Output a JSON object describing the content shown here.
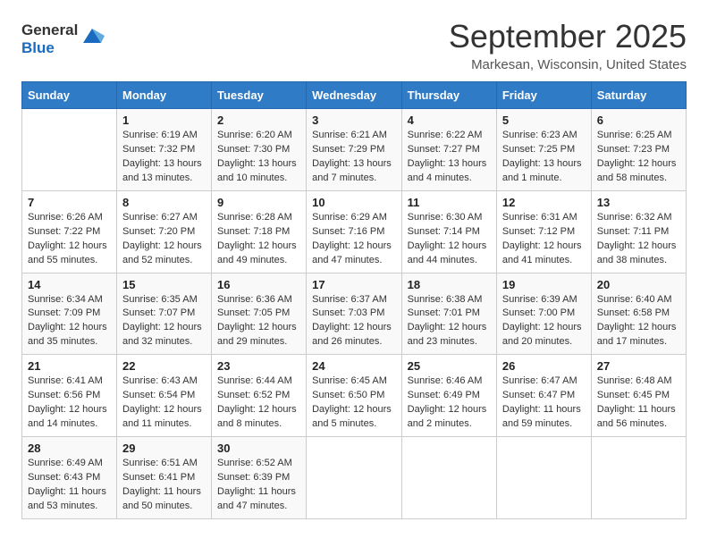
{
  "logo": {
    "general": "General",
    "blue": "Blue"
  },
  "title": "September 2025",
  "location": "Markesan, Wisconsin, United States",
  "weekdays": [
    "Sunday",
    "Monday",
    "Tuesday",
    "Wednesday",
    "Thursday",
    "Friday",
    "Saturday"
  ],
  "weeks": [
    [
      {
        "day": "",
        "info": ""
      },
      {
        "day": "1",
        "info": "Sunrise: 6:19 AM\nSunset: 7:32 PM\nDaylight: 13 hours and 13 minutes."
      },
      {
        "day": "2",
        "info": "Sunrise: 6:20 AM\nSunset: 7:30 PM\nDaylight: 13 hours and 10 minutes."
      },
      {
        "day": "3",
        "info": "Sunrise: 6:21 AM\nSunset: 7:29 PM\nDaylight: 13 hours and 7 minutes."
      },
      {
        "day": "4",
        "info": "Sunrise: 6:22 AM\nSunset: 7:27 PM\nDaylight: 13 hours and 4 minutes."
      },
      {
        "day": "5",
        "info": "Sunrise: 6:23 AM\nSunset: 7:25 PM\nDaylight: 13 hours and 1 minute."
      },
      {
        "day": "6",
        "info": "Sunrise: 6:25 AM\nSunset: 7:23 PM\nDaylight: 12 hours and 58 minutes."
      }
    ],
    [
      {
        "day": "7",
        "info": "Sunrise: 6:26 AM\nSunset: 7:22 PM\nDaylight: 12 hours and 55 minutes."
      },
      {
        "day": "8",
        "info": "Sunrise: 6:27 AM\nSunset: 7:20 PM\nDaylight: 12 hours and 52 minutes."
      },
      {
        "day": "9",
        "info": "Sunrise: 6:28 AM\nSunset: 7:18 PM\nDaylight: 12 hours and 49 minutes."
      },
      {
        "day": "10",
        "info": "Sunrise: 6:29 AM\nSunset: 7:16 PM\nDaylight: 12 hours and 47 minutes."
      },
      {
        "day": "11",
        "info": "Sunrise: 6:30 AM\nSunset: 7:14 PM\nDaylight: 12 hours and 44 minutes."
      },
      {
        "day": "12",
        "info": "Sunrise: 6:31 AM\nSunset: 7:12 PM\nDaylight: 12 hours and 41 minutes."
      },
      {
        "day": "13",
        "info": "Sunrise: 6:32 AM\nSunset: 7:11 PM\nDaylight: 12 hours and 38 minutes."
      }
    ],
    [
      {
        "day": "14",
        "info": "Sunrise: 6:34 AM\nSunset: 7:09 PM\nDaylight: 12 hours and 35 minutes."
      },
      {
        "day": "15",
        "info": "Sunrise: 6:35 AM\nSunset: 7:07 PM\nDaylight: 12 hours and 32 minutes."
      },
      {
        "day": "16",
        "info": "Sunrise: 6:36 AM\nSunset: 7:05 PM\nDaylight: 12 hours and 29 minutes."
      },
      {
        "day": "17",
        "info": "Sunrise: 6:37 AM\nSunset: 7:03 PM\nDaylight: 12 hours and 26 minutes."
      },
      {
        "day": "18",
        "info": "Sunrise: 6:38 AM\nSunset: 7:01 PM\nDaylight: 12 hours and 23 minutes."
      },
      {
        "day": "19",
        "info": "Sunrise: 6:39 AM\nSunset: 7:00 PM\nDaylight: 12 hours and 20 minutes."
      },
      {
        "day": "20",
        "info": "Sunrise: 6:40 AM\nSunset: 6:58 PM\nDaylight: 12 hours and 17 minutes."
      }
    ],
    [
      {
        "day": "21",
        "info": "Sunrise: 6:41 AM\nSunset: 6:56 PM\nDaylight: 12 hours and 14 minutes."
      },
      {
        "day": "22",
        "info": "Sunrise: 6:43 AM\nSunset: 6:54 PM\nDaylight: 12 hours and 11 minutes."
      },
      {
        "day": "23",
        "info": "Sunrise: 6:44 AM\nSunset: 6:52 PM\nDaylight: 12 hours and 8 minutes."
      },
      {
        "day": "24",
        "info": "Sunrise: 6:45 AM\nSunset: 6:50 PM\nDaylight: 12 hours and 5 minutes."
      },
      {
        "day": "25",
        "info": "Sunrise: 6:46 AM\nSunset: 6:49 PM\nDaylight: 12 hours and 2 minutes."
      },
      {
        "day": "26",
        "info": "Sunrise: 6:47 AM\nSunset: 6:47 PM\nDaylight: 11 hours and 59 minutes."
      },
      {
        "day": "27",
        "info": "Sunrise: 6:48 AM\nSunset: 6:45 PM\nDaylight: 11 hours and 56 minutes."
      }
    ],
    [
      {
        "day": "28",
        "info": "Sunrise: 6:49 AM\nSunset: 6:43 PM\nDaylight: 11 hours and 53 minutes."
      },
      {
        "day": "29",
        "info": "Sunrise: 6:51 AM\nSunset: 6:41 PM\nDaylight: 11 hours and 50 minutes."
      },
      {
        "day": "30",
        "info": "Sunrise: 6:52 AM\nSunset: 6:39 PM\nDaylight: 11 hours and 47 minutes."
      },
      {
        "day": "",
        "info": ""
      },
      {
        "day": "",
        "info": ""
      },
      {
        "day": "",
        "info": ""
      },
      {
        "day": "",
        "info": ""
      }
    ]
  ]
}
